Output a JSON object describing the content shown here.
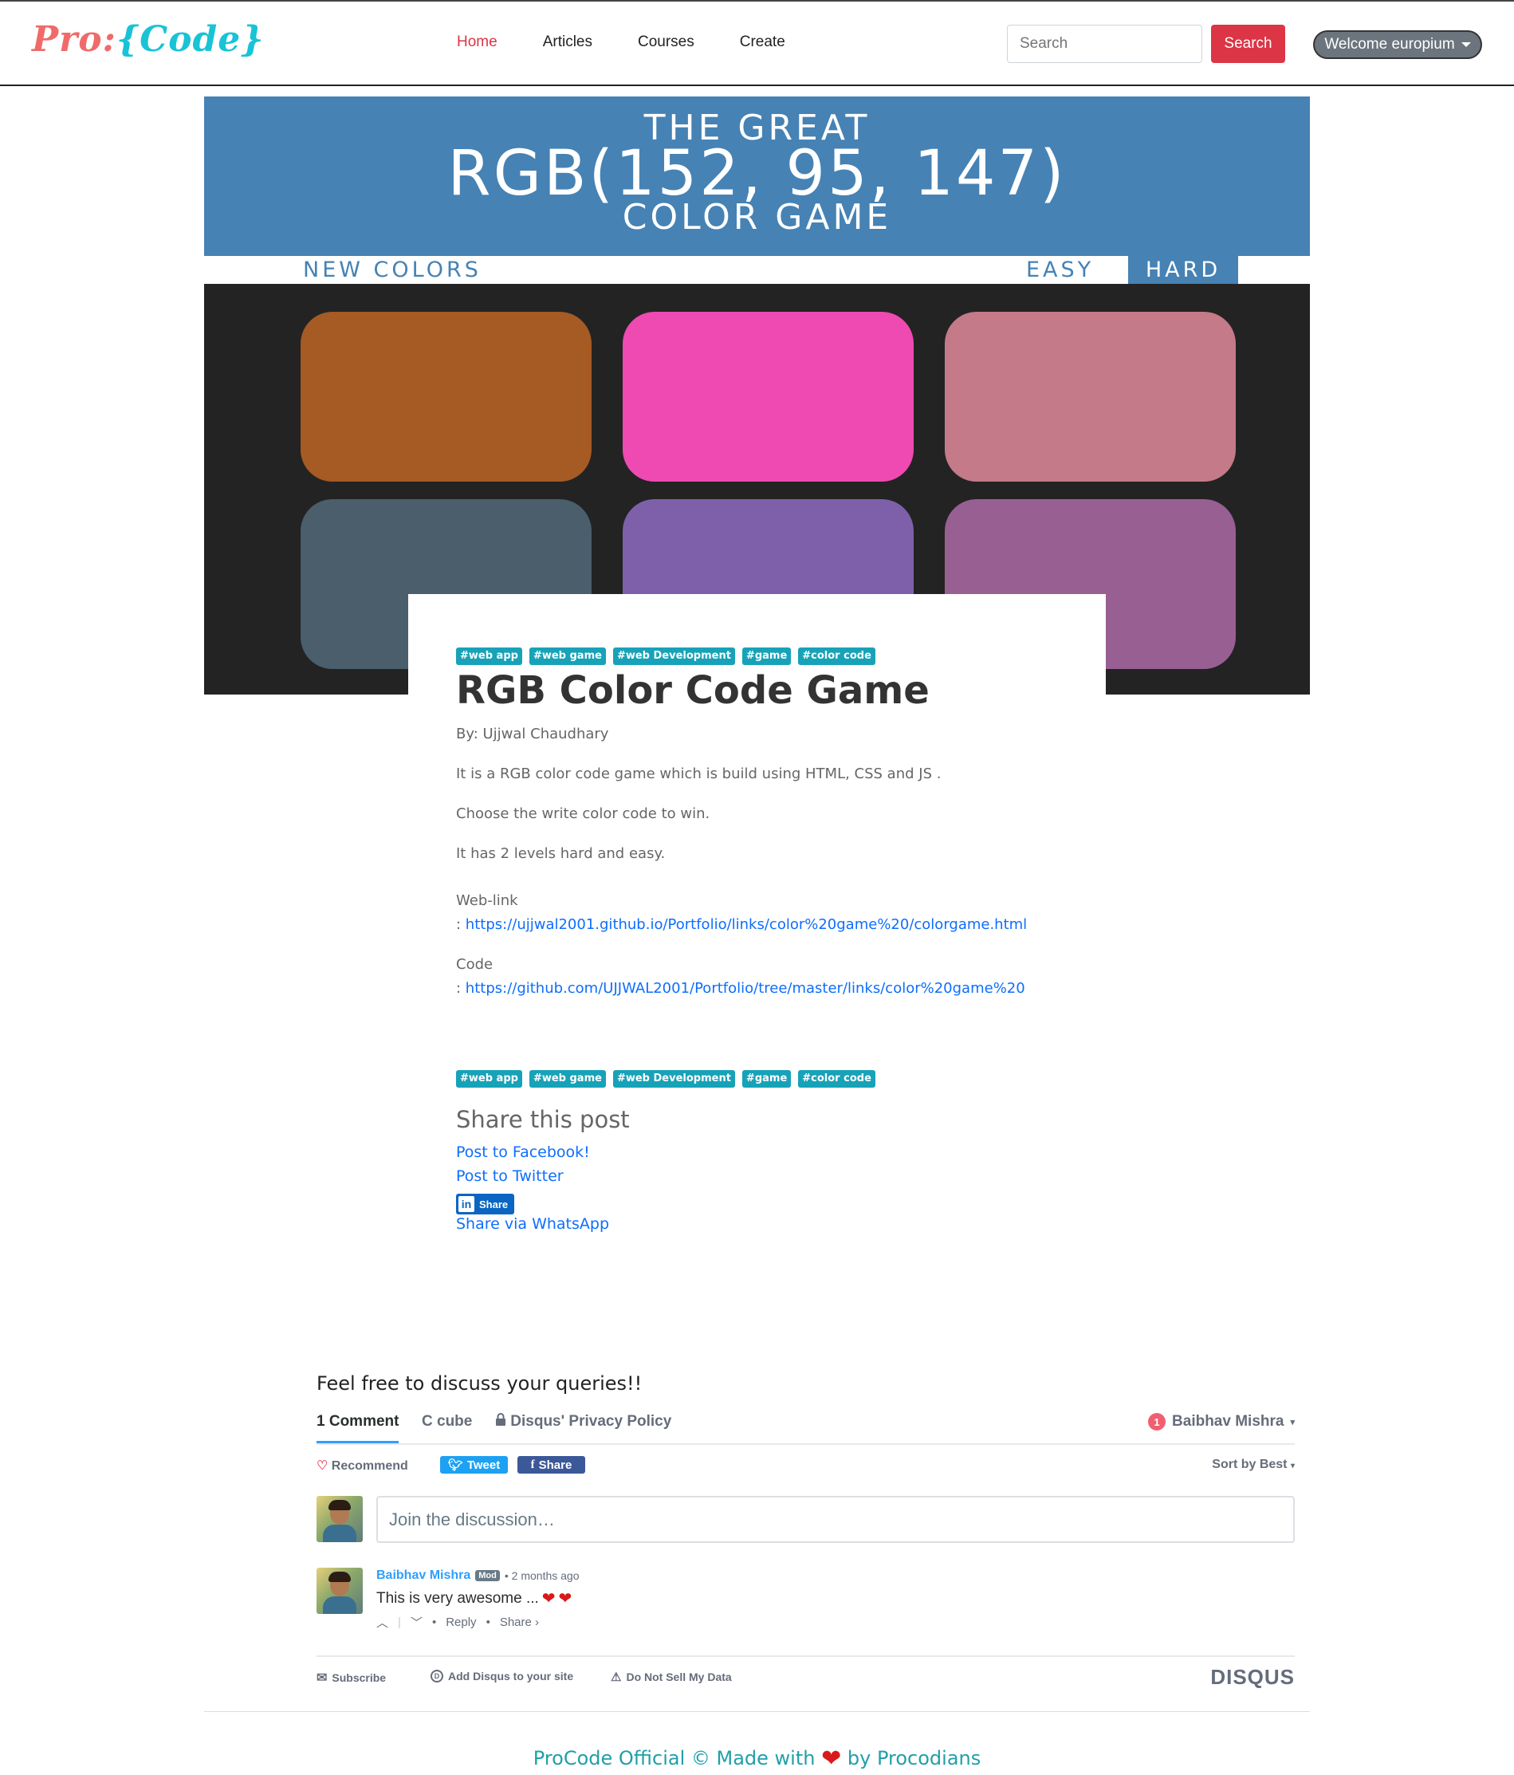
{
  "navbar": {
    "brand_part1": "Pro:",
    "brand_part2": "{Code}",
    "links": [
      "Home",
      "Articles",
      "Courses",
      "Create"
    ],
    "search_placeholder": "Search",
    "search_button": "Search",
    "user_button": "Welcome europium"
  },
  "hero": {
    "line1": "THE GREAT",
    "line2": "RGB(152, 95, 147)",
    "line3": "COLOR GAME",
    "new_colors": "NEW COLORS",
    "easy": "EASY",
    "hard": "HARD",
    "square_colors": [
      "#a65a24",
      "#ee4ab2",
      "#c47a88",
      "#4a5e6b",
      "#7e60aa",
      "#985f93"
    ]
  },
  "post": {
    "tags": [
      "#web app",
      "#web game",
      "#web Development",
      "#game",
      "#color code"
    ],
    "title": "RGB Color Code Game",
    "author": "By: Ujjwal Chaudhary",
    "para1": "It is a RGB color code game which is build using HTML, CSS and JS .",
    "para2": "Choose the write color code to win.",
    "para3": "It has 2 levels hard and easy.",
    "weblink_label": "Web-link",
    "weblink_prefix": ": ",
    "weblink_url": "https://ujjwal2001.github.io/Portfolio/links/color%20game%20/colorgame.html",
    "code_label": "Code",
    "code_prefix": ": ",
    "code_url": "https://github.com/UJJWAL2001/Portfolio/tree/master/links/color%20game%20"
  },
  "share": {
    "heading": "Share this post",
    "facebook": "Post to Facebook!",
    "twitter": "Post to Twitter",
    "linkedin_logo": "in",
    "linkedin": "Share",
    "whatsapp": "Share via WhatsApp"
  },
  "discussion": {
    "heading": "Feel free to discuss your queries!!",
    "tab_comments": "1 Comment",
    "tab_community": "C cube",
    "tab_privacy": "Disqus' Privacy Policy",
    "notif_count": "1",
    "user": "Baibhav Mishra",
    "recommend": "Recommend",
    "tweet": "Tweet",
    "fb_share": "Share",
    "sort": "Sort by Best",
    "join_placeholder": "Join the discussion…",
    "comment": {
      "author": "Baibhav Mishra",
      "badge": "Mod",
      "time": "• 2 months ago",
      "text": "This is very awesome ...",
      "reply": "Reply",
      "share": "Share ›"
    },
    "footer": {
      "subscribe": "Subscribe",
      "add_disqus": "Add Disqus to your site",
      "do_not_sell": "Do Not Sell My Data",
      "logo": "DISQUS"
    }
  },
  "footer": {
    "prefix": "ProCode Official © Made with",
    "suffix": "by Procodians"
  }
}
